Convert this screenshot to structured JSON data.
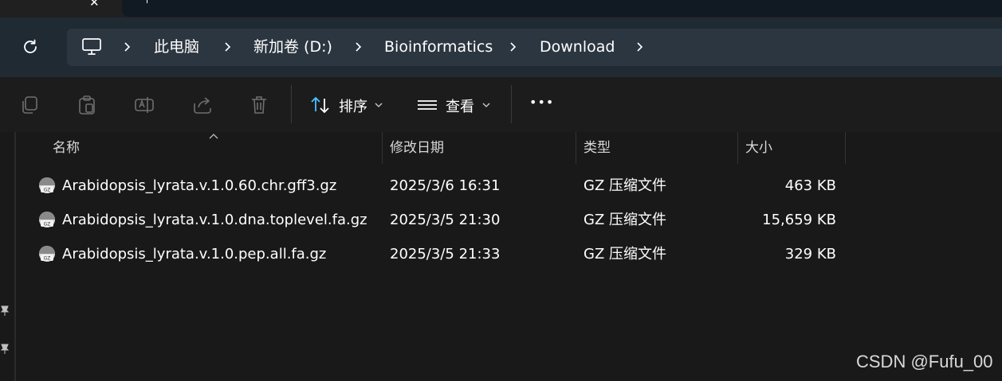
{
  "window": {
    "tab_close_icon": "close-icon",
    "new_tab_icon": "plus-icon"
  },
  "navigation": {
    "refresh_icon": "refresh-icon",
    "breadcrumb": [
      {
        "label": "",
        "icon": "computer-icon"
      },
      {
        "label": "此电脑"
      },
      {
        "label": "新加卷 (D:)"
      },
      {
        "label": "Bioinformatics"
      },
      {
        "label": "Download"
      }
    ]
  },
  "toolbar": {
    "copy_icon": "copy-icon",
    "paste_icon": "paste-icon",
    "rename_icon": "rename-icon",
    "share_icon": "share-icon",
    "delete_icon": "delete-icon",
    "sort_label": "排序",
    "view_label": "查看",
    "more_label": "•••"
  },
  "table": {
    "columns": [
      "名称",
      "修改日期",
      "类型",
      "大小"
    ],
    "sorted_column": "名称",
    "rows": [
      {
        "name": "Arabidopsis_lyrata.v.1.0.60.chr.gff3.gz",
        "date": "2025/3/6 16:31",
        "type": "GZ 压缩文件",
        "size": "463 KB"
      },
      {
        "name": "Arabidopsis_lyrata.v.1.0.dna.toplevel.fa.gz",
        "date": "2025/3/5 21:30",
        "type": "GZ 压缩文件",
        "size": "15,659 KB"
      },
      {
        "name": "Arabidopsis_lyrata.v.1.0.pep.all.fa.gz",
        "date": "2025/3/5 21:33",
        "type": "GZ 压缩文件",
        "size": "329 KB"
      }
    ],
    "file_icon_label": "GZ"
  },
  "watermark": "CSDN @Fufu_00",
  "colors": {
    "background": "#191919",
    "navbar": "#202a33",
    "breadcrumb": "#2c3640",
    "accent": "#4cc2ff"
  }
}
